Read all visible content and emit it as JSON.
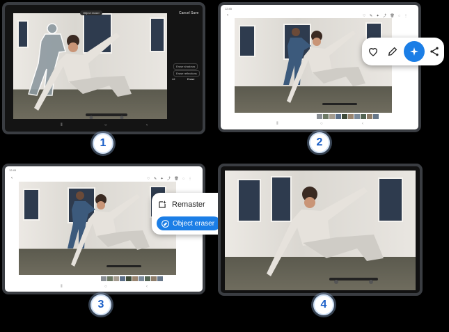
{
  "steps": [
    "1",
    "2",
    "3",
    "4"
  ],
  "panel1": {
    "top_pill": "Object eraser",
    "cancel": "Cancel",
    "save": "Save",
    "side_option_1": "Erase shadows",
    "side_option_2": "Erase reflections",
    "side_all": "All",
    "side_erase": "Erase"
  },
  "panel2": {
    "time": "12:45",
    "toolbar_icons": [
      "heart-icon",
      "pencil-icon",
      "sparkle-icon",
      "share-icon"
    ]
  },
  "panel3": {
    "time": "12:45",
    "menu": {
      "remaster_label": "Remaster",
      "object_eraser_label": "Object eraser"
    }
  },
  "colors": {
    "accent": "#1b7ee6",
    "tablet_frame": "#3a3d42",
    "badge_text": "#1a5fc8"
  }
}
